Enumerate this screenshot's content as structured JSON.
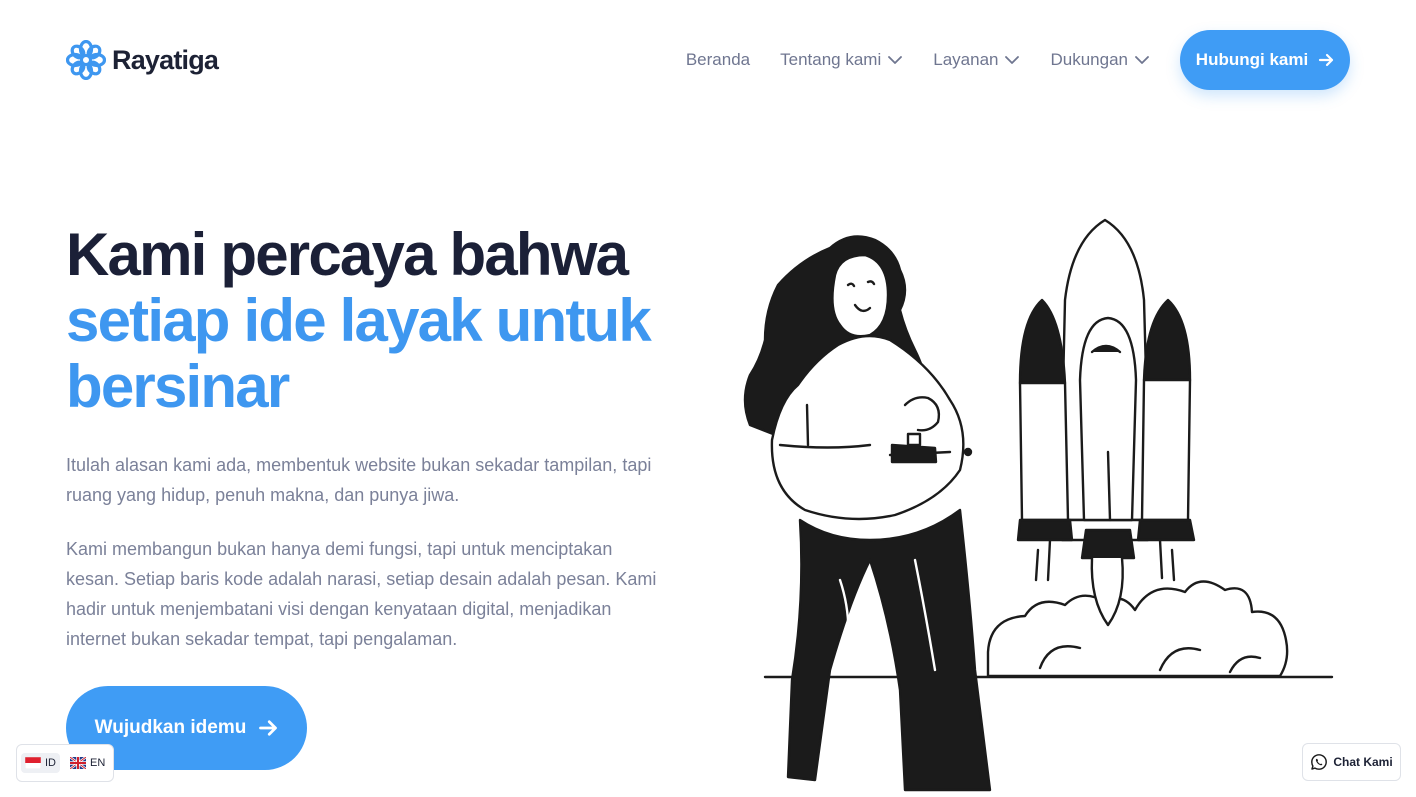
{
  "brand": {
    "name": "Rayatiga",
    "logo_icon": "flower-icon",
    "accent": "#3f9cf5"
  },
  "nav": {
    "items": [
      {
        "label": "Beranda",
        "has_dropdown": false
      },
      {
        "label": "Tentang kami",
        "has_dropdown": true
      },
      {
        "label": "Layanan",
        "has_dropdown": true
      },
      {
        "label": "Dukungan",
        "has_dropdown": true
      }
    ],
    "cta_label": "Hubungi kami"
  },
  "hero": {
    "title_line1": "Kami percaya bahwa",
    "title_highlight_line1": "setiap ide layak untuk",
    "title_highlight_line2": "bersinar",
    "paragraph1": "Itulah alasan kami ada, membentuk website bukan sekadar tampilan, tapi ruang yang hidup, penuh makna, dan punya jiwa.",
    "paragraph2": "Kami membangun bukan hanya demi fungsi, tapi untuk menciptakan kesan. Setiap baris kode adalah narasi, setiap desain adalah pesan. Kami hadir untuk menjembatani visi dengan kenyataan digital, menjadikan internet bukan sekadar tempat, tapi pengalaman.",
    "cta_label": "Wujudkan idemu",
    "illustration": "woman-launching-rocket-illustration"
  },
  "language_switcher": {
    "options": [
      {
        "code": "ID",
        "flag": "indonesia-flag-icon",
        "active": true
      },
      {
        "code": "EN",
        "flag": "uk-flag-icon",
        "active": false
      }
    ]
  },
  "chat_widget": {
    "label": "Chat Kami",
    "icon": "whatsapp-icon"
  },
  "colors": {
    "heading_dark": "#1b2037",
    "heading_blue": "#3e97f0",
    "body_text": "#7b8199",
    "nav_text": "#6f7690"
  }
}
